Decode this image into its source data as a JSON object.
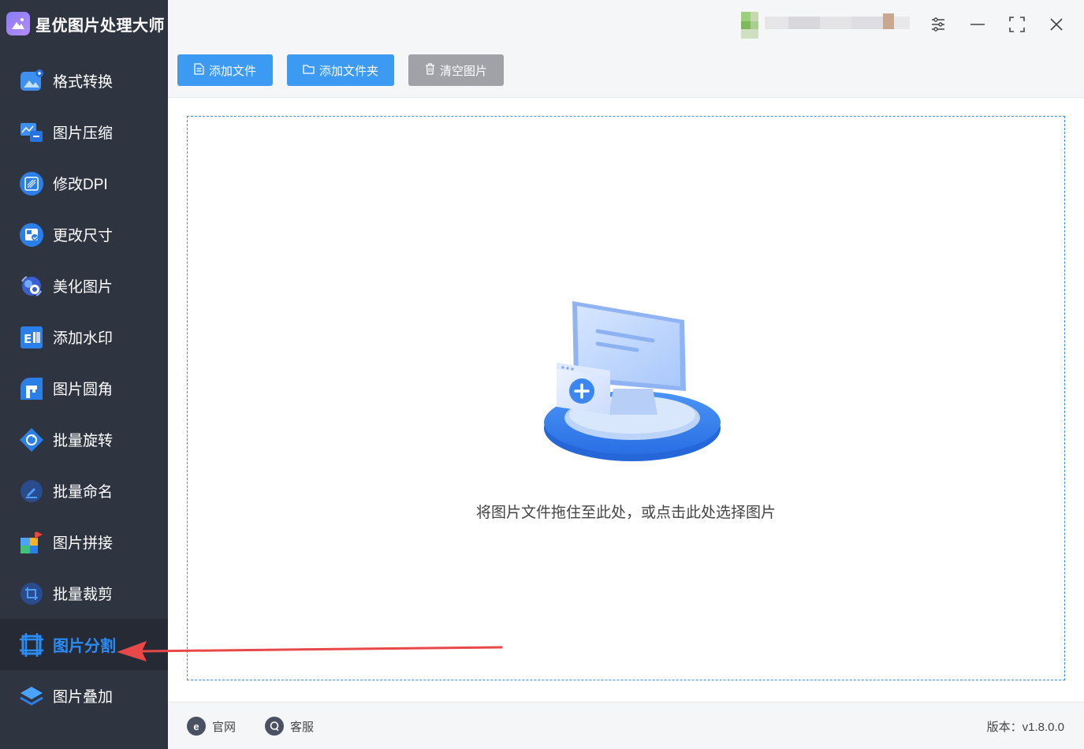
{
  "app": {
    "title": "星优图片处理大师"
  },
  "sidebar": {
    "items": [
      {
        "label": "格式转换",
        "icon": "image-convert-icon"
      },
      {
        "label": "图片压缩",
        "icon": "image-compress-icon"
      },
      {
        "label": "修改DPI",
        "icon": "dpi-icon"
      },
      {
        "label": "更改尺寸",
        "icon": "resize-icon"
      },
      {
        "label": "美化图片",
        "icon": "beautify-icon"
      },
      {
        "label": "添加水印",
        "icon": "watermark-icon"
      },
      {
        "label": "图片圆角",
        "icon": "round-corner-icon"
      },
      {
        "label": "批量旋转",
        "icon": "rotate-icon"
      },
      {
        "label": "批量命名",
        "icon": "rename-icon"
      },
      {
        "label": "图片拼接",
        "icon": "puzzle-icon"
      },
      {
        "label": "批量裁剪",
        "icon": "crop-icon"
      },
      {
        "label": "图片分割",
        "icon": "split-icon",
        "active": true
      },
      {
        "label": "图片叠加",
        "icon": "layers-icon"
      }
    ]
  },
  "toolbar": {
    "add_file": "添加文件",
    "add_folder": "添加文件夹",
    "clear_images": "清空图片"
  },
  "dropzone": {
    "text": "将图片文件拖住至此处，或点击此处选择图片"
  },
  "footer": {
    "website": "官网",
    "support": "客服",
    "version": "版本：v1.8.0.0"
  },
  "colors": {
    "accent": "#3d9af3",
    "sidebar": "#2f3441",
    "active_label": "#2b8cf5",
    "annotation_arrow": "#e94848"
  }
}
